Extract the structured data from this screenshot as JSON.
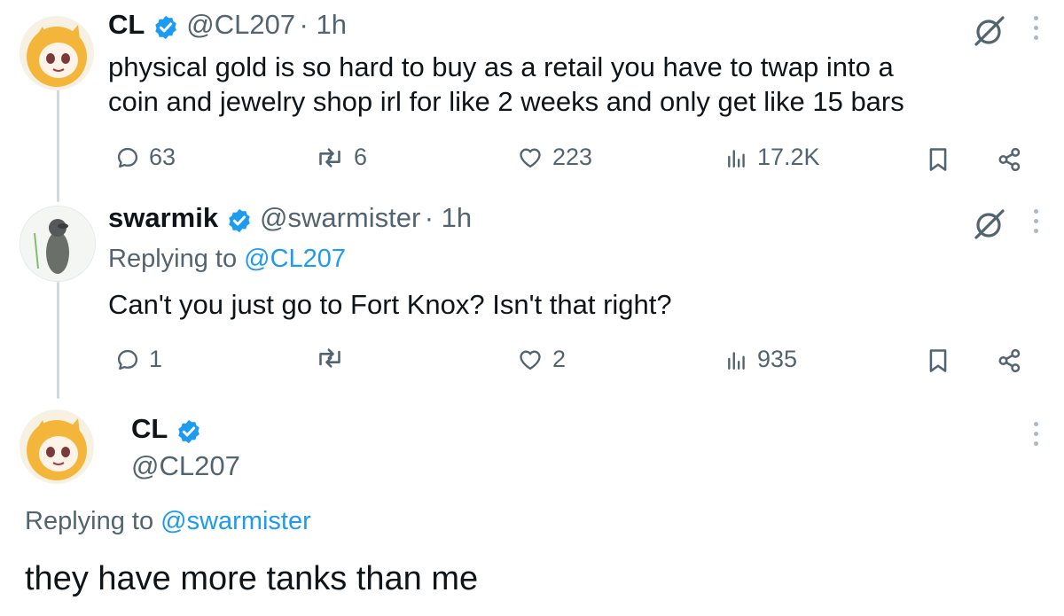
{
  "tweet1": {
    "name": "CL",
    "handle": "@CL207",
    "time": "· 1h",
    "text_line1": "physical gold is so hard to buy as a retail you have to twap into a",
    "text_line2": "coin and jewelry shop irl for like 2 weeks and only get like 15 bars",
    "replies": "63",
    "reposts": "6",
    "likes": "223",
    "views": "17.2K"
  },
  "tweet2": {
    "name": "swarmik",
    "handle": "@swarmister",
    "time": "· 1h",
    "replying_prefix": "Replying to",
    "replying_handle": "@CL207",
    "text": "Can't you just go to Fort Knox? Isn't that right?",
    "replies": "1",
    "likes": "2",
    "views": "935"
  },
  "tweet3": {
    "name": "CL",
    "handle": "@CL207",
    "replying_prefix": "Replying to",
    "replying_handle": "@swarmister",
    "text": "they have more tanks than me"
  },
  "colors": {
    "verified": "#1d9bf0",
    "link": "#1d9bf0",
    "secondary": "#536471",
    "thread_line": "#cfd9de"
  },
  "icons": [
    "reply-icon",
    "repost-icon",
    "like-icon",
    "views-icon",
    "bookmark-icon",
    "share-icon",
    "verified-icon",
    "grok-icon",
    "more-icon"
  ]
}
